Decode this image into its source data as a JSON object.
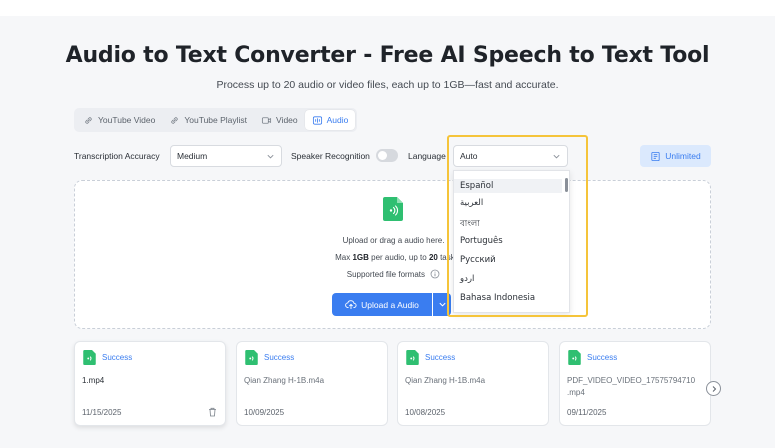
{
  "page": {
    "title": "Audio to Text Converter - Free AI Speech to Text Tool",
    "subtitle": "Process up to 20 audio or video files, each up to 1GB—fast and accurate."
  },
  "tabs": [
    {
      "label": "YouTube Video",
      "icon": "link-icon",
      "active": false
    },
    {
      "label": "YouTube Playlist",
      "icon": "link-icon",
      "active": false
    },
    {
      "label": "Video",
      "icon": "video-icon",
      "active": false
    },
    {
      "label": "Audio",
      "icon": "audio-icon",
      "active": true
    }
  ],
  "options": {
    "accuracy_label": "Transcription Accuracy",
    "accuracy_value": "Medium",
    "speaker_label": "Speaker Recognition",
    "speaker_enabled": false,
    "language_label": "Language",
    "language_value": "Auto",
    "unlimited_label": "Unlimited"
  },
  "language_dropdown": {
    "items": [
      "Español",
      "العربية",
      "বাংলা",
      "Português",
      "Русский",
      "اردو",
      "Bahasa Indonesia"
    ],
    "hovered": "Español"
  },
  "upload": {
    "line1": "Upload or drag a audio here.",
    "line2_prefix": "Max ",
    "line2_size": "1GB",
    "line2_mid": " per audio, up to ",
    "line2_count": "20",
    "line2_suffix": " tasks in q",
    "formats_label": "Supported file formats",
    "button_label": "Upload a Audio"
  },
  "files": [
    {
      "status": "Success",
      "name": "1.mp4",
      "date": "11/15/2025"
    },
    {
      "status": "Success",
      "name": "Qian Zhang H-1B.m4a",
      "date": "10/09/2025"
    },
    {
      "status": "Success",
      "name": "Qian Zhang H-1B.m4a",
      "date": "10/08/2025"
    },
    {
      "status": "Success",
      "name": "PDF_VIDEO_VIDEO_17575794710",
      "name_line2": ".mp4",
      "date": "09/11/2025"
    }
  ],
  "colors": {
    "accent": "#3a7df0",
    "success_green": "#2fbf71",
    "highlight": "#f5c43a"
  }
}
